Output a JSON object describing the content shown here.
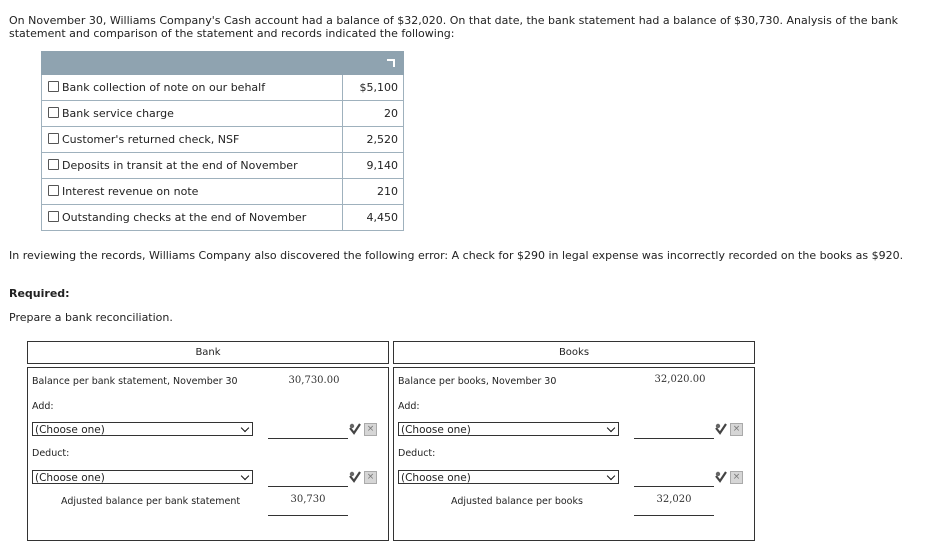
{
  "intro": "On November 30, Williams Company's Cash account had a balance of $32,020. On that date, the bank statement had a balance of $30,730. Analysis of the bank statement and comparison of the statement and records indicated the following:",
  "items": [
    {
      "label": "Bank collection of note on our behalf",
      "amount": "$5,100"
    },
    {
      "label": "Bank service charge",
      "amount": "20"
    },
    {
      "label": "Customer's returned check, NSF",
      "amount": "2,520"
    },
    {
      "label": "Deposits in transit at the end of November",
      "amount": "9,140"
    },
    {
      "label": "Interest revenue on note",
      "amount": "210"
    },
    {
      "label": "Outstanding checks at the end of November",
      "amount": "4,450"
    }
  ],
  "error_text": "In reviewing the records, Williams Company also discovered the following error: A check for $290 in legal expense was incorrectly recorded on the books as $920.",
  "required_heading": "Required:",
  "required_text": "Prepare a bank reconciliation.",
  "bank": {
    "title": "Bank",
    "balance_label": "Balance per bank statement, November 30",
    "balance_value": "30,730.00",
    "add_label": "Add:",
    "add_select": "(Choose one)",
    "deduct_label": "Deduct:",
    "deduct_select": "(Choose one)",
    "adjusted_label": "Adjusted balance per bank statement",
    "adjusted_value": "30,730"
  },
  "books": {
    "title": "Books",
    "balance_label": "Balance per books, November 30",
    "balance_value": "32,020.00",
    "add_label": "Add:",
    "add_select": "(Choose one)",
    "deduct_label": "Deduct:",
    "deduct_select": "(Choose one)",
    "adjusted_label": "Adjusted balance per books",
    "adjusted_value": "32,020"
  },
  "icons": {
    "check": "check-icon",
    "close": "close-icon"
  }
}
